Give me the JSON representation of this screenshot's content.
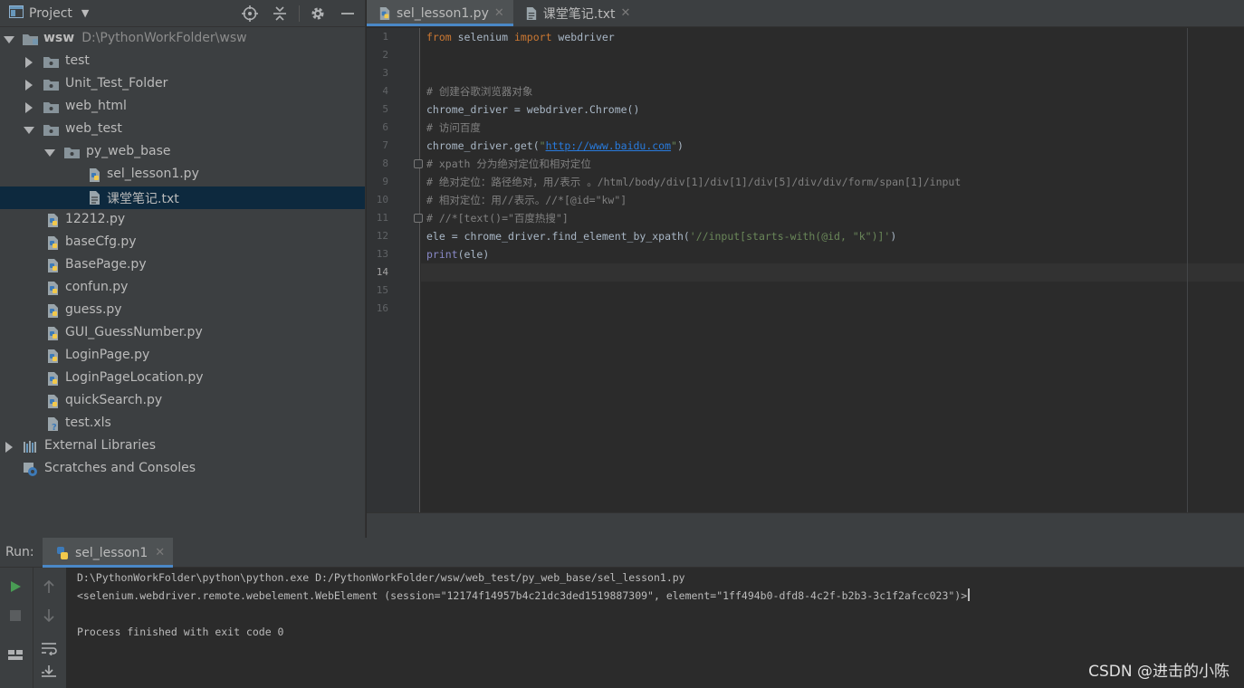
{
  "project_panel": {
    "title": "Project",
    "tree": [
      {
        "label": "wsw",
        "path": "D:\\PythonWorkFolder\\wsw"
      },
      {
        "label": "test"
      },
      {
        "label": "Unit_Test_Folder"
      },
      {
        "label": "web_html"
      },
      {
        "label": "web_test"
      },
      {
        "label": "py_web_base"
      },
      {
        "label": "sel_lesson1.py"
      },
      {
        "label": "课堂笔记.txt"
      },
      {
        "label": "12212.py"
      },
      {
        "label": "baseCfg.py"
      },
      {
        "label": "BasePage.py"
      },
      {
        "label": "confun.py"
      },
      {
        "label": "guess.py"
      },
      {
        "label": "GUI_GuessNumber.py"
      },
      {
        "label": "LoginPage.py"
      },
      {
        "label": "LoginPageLocation.py"
      },
      {
        "label": "quickSearch.py"
      },
      {
        "label": "test.xls"
      },
      {
        "label": "External Libraries"
      },
      {
        "label": "Scratches and Consoles"
      }
    ]
  },
  "editor": {
    "tabs": [
      {
        "label": "sel_lesson1.py",
        "close": "✕"
      },
      {
        "label": "课堂笔记.txt",
        "close": "✕"
      }
    ],
    "line_numbers": [
      "1",
      "2",
      "3",
      "4",
      "5",
      "6",
      "7",
      "8",
      "9",
      "10",
      "11",
      "12",
      "13",
      "14",
      "15",
      "16"
    ],
    "code": {
      "l1_kw1": "from",
      "l1_mid": " selenium ",
      "l1_kw2": "import",
      "l1_end": " webdriver",
      "l4": "# 创建谷歌浏览器对象",
      "l5": "chrome_driver = webdriver.Chrome()",
      "l6": "# 访问百度",
      "l7_pre": "chrome_driver.get(",
      "l7_q": "\"",
      "l7_url": "http://www.baidu.com",
      "l7_post": ")",
      "l8": "# xpath 分为绝对定位和相对定位",
      "l9": "# 绝对定位：路径绝对，用/表示 。/html/body/div[1]/div[1]/div[5]/div/div/form/span[1]/input",
      "l10": "# 相对定位：用//表示。//*[@id=\"kw\"]",
      "l11": "# //*[text()=\"百度热搜\"]",
      "l12_pre": "ele = chrome_driver.find_element_by_xpath(",
      "l12_str": "'//input[starts-with(@id, \"k\")]'",
      "l12_post": ")",
      "l13_fn": "print",
      "l13_rest": "(ele)"
    }
  },
  "run_panel": {
    "label": "Run:",
    "tab_label": "sel_lesson1",
    "tab_close": "✕",
    "console": {
      "cmd": "D:\\PythonWorkFolder\\python\\python.exe D:/PythonWorkFolder/wsw/web_test/py_web_base/sel_lesson1.py",
      "output": "<selenium.webdriver.remote.webelement.WebElement (session=\"12174f14957b4c21dc3ded1519887309\", element=\"1ff494b0-dfd8-4c2f-b2b3-3c1f2afcc023\")>",
      "exit": "Process finished with exit code 0"
    }
  },
  "watermark": "CSDN @进击的小陈",
  "colors": {
    "accent": "#4a88c7",
    "selection": "#0d293e",
    "keyword": "#cc7832",
    "comment": "#808080",
    "string": "#6a8759",
    "url": "#287bde",
    "run_green": "#499c54"
  }
}
